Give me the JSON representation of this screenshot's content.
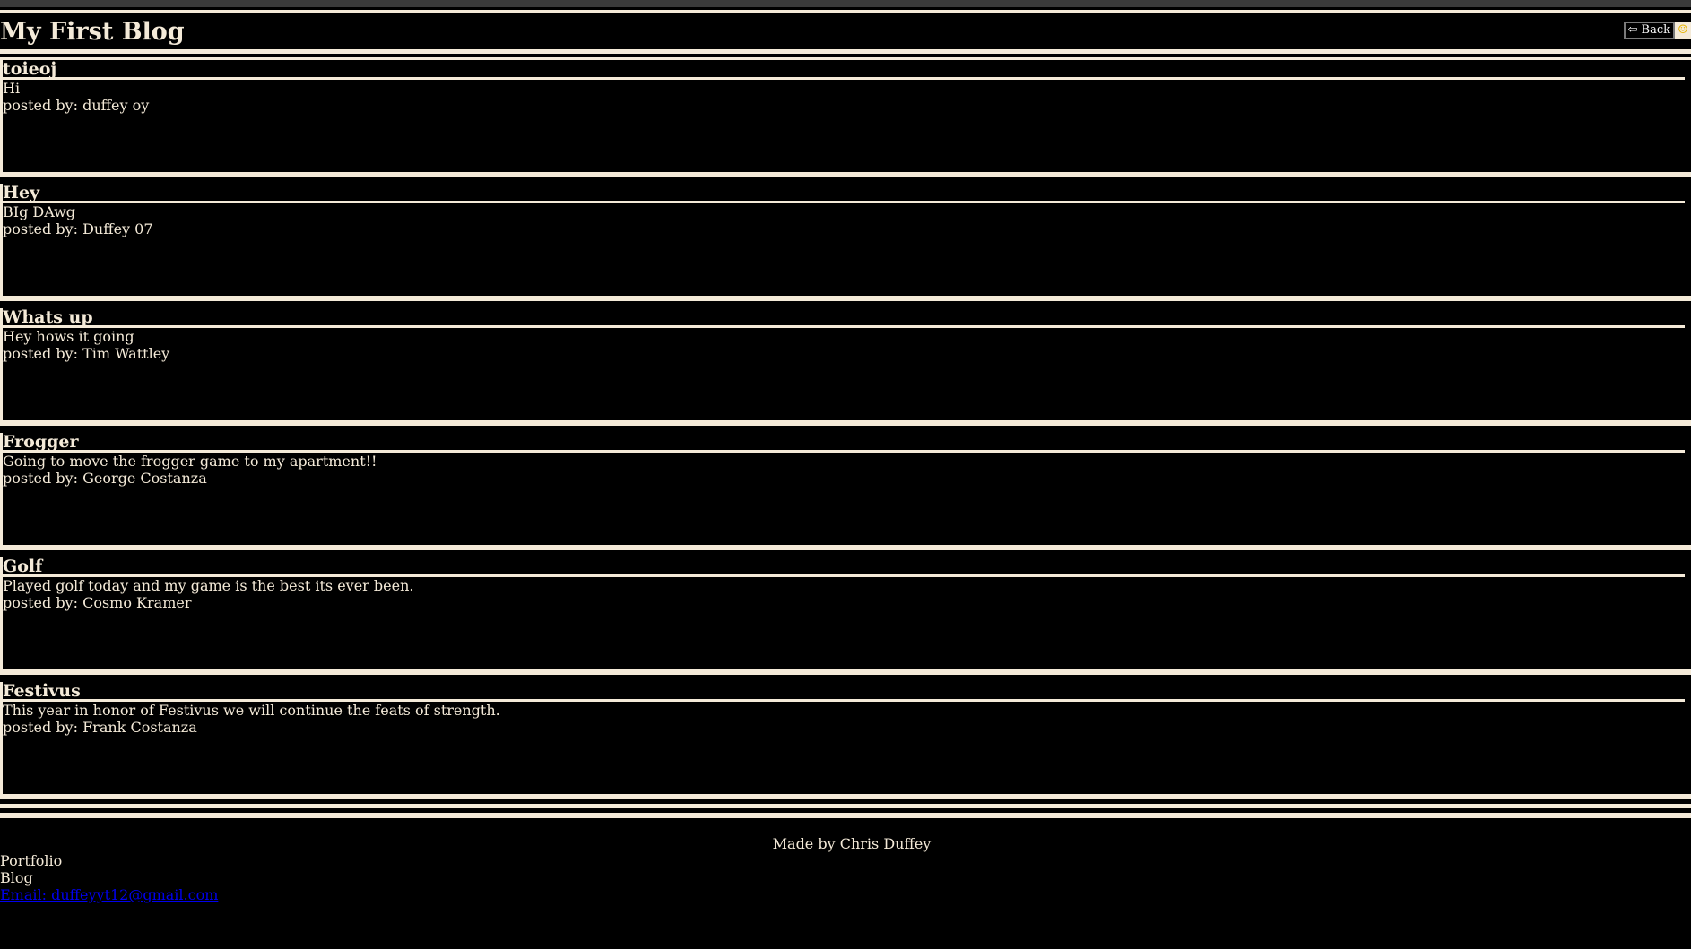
{
  "header": {
    "title": "My First Blog",
    "back_label": "⇦ Back",
    "smile_icon": "☺"
  },
  "posts": [
    {
      "title": "toieoj",
      "body": "Hi",
      "author": "posted by: duffey oy"
    },
    {
      "title": "Hey",
      "body": "BIg DAwg",
      "author": "posted by: Duffey 07"
    },
    {
      "title": "Whats up",
      "body": "Hey hows it going",
      "author": "posted by: Tim Wattley"
    },
    {
      "title": "Frogger",
      "body": "Going to move the frogger game to my apartment!!",
      "author": "posted by: George Costanza"
    },
    {
      "title": "Golf",
      "body": "Played golf today and my game is the best its ever been.",
      "author": "posted by: Cosmo Kramer"
    },
    {
      "title": "Festivus",
      "body": "This year in honor of Festivus we will continue the feats of strength.",
      "author": "posted by: Frank Costanza"
    }
  ],
  "footer": {
    "credit": "Made by Chris Duffey",
    "portfolio_label": "Portfolio",
    "blog_label": "Blog",
    "email_label": "Email: duffeyyt12@gmail.com"
  },
  "colors": {
    "background": "#000000",
    "text": "#f4ead8",
    "link": "#0000ee"
  }
}
